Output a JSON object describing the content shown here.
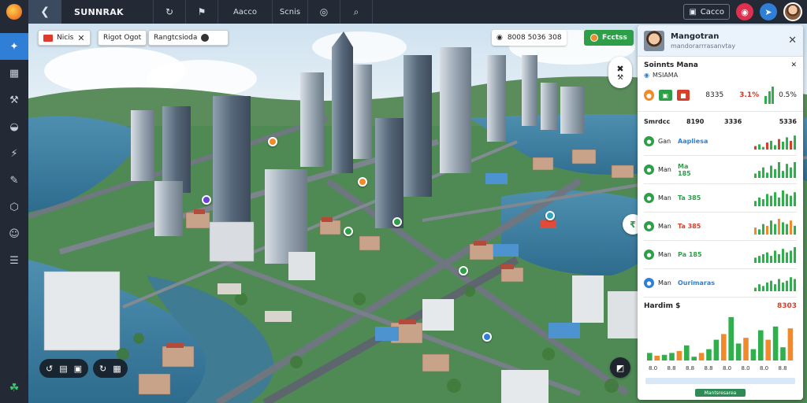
{
  "topbar": {
    "brand": "SUNNRAK",
    "back_icon": "back-arrow-icon",
    "buttons": [
      {
        "label": "",
        "icon": "refresh-icon"
      },
      {
        "label": "",
        "icon": "flag-icon"
      },
      {
        "label": "Aacco",
        "icon": ""
      },
      {
        "label": "Scnis",
        "icon": ""
      },
      {
        "label": "",
        "icon": "target-icon"
      },
      {
        "label": "",
        "icon": "search-icon"
      }
    ],
    "currency_label": "Cacco"
  },
  "sidebar": {
    "items": [
      "add-zone-icon",
      "building-icon",
      "tools-icon",
      "vehicle-icon",
      "power-icon",
      "edit-icon",
      "water-icon",
      "happy-icon",
      "report-icon"
    ],
    "bottom": "settings-icon"
  },
  "map": {
    "chips": [
      {
        "label": "Nicis"
      },
      {
        "label": "Rigot Ogot"
      },
      {
        "label": "Rangtcsioda"
      }
    ],
    "stat_pill": {
      "text": "8008 5036 308"
    },
    "green_button": {
      "label": "Fcctss"
    }
  },
  "panel": {
    "title": "Mangotran",
    "subtitle": "mandorarrrasanvtay",
    "section1": {
      "heading": "Soinnts Mana",
      "sub": "MSIAMA",
      "values": [
        "8335",
        "3.1%",
        "0.5%"
      ]
    },
    "table": {
      "headers": [
        "Smrdcc",
        "8190",
        "3336"
      ],
      "right_header": "5336",
      "rows": [
        {
          "name": "Gan",
          "value": "Aapliesa",
          "color": "#2e9e49"
        },
        {
          "name": "Man",
          "value": "Ma 185",
          "color": "#2e9e49"
        },
        {
          "name": "Man",
          "value": "Ta 385",
          "color": "#2e9e49"
        },
        {
          "name": "Man",
          "value": "Ta 385",
          "color": "#2e9e49"
        },
        {
          "name": "Man",
          "value": "Pa 185",
          "color": "#2e9e49"
        },
        {
          "name": "Man",
          "value": "Ourimaras",
          "color": "#2f7fd6"
        }
      ]
    },
    "big_chart": {
      "heading": "Hardim $",
      "right_label": "8303",
      "x_labels": [
        "8.0",
        "8.8",
        "8.8",
        "8.8",
        "8.0",
        "8.0",
        "8.0",
        "8.8"
      ],
      "button_label": "Mantsresarea"
    }
  },
  "chart_data": {
    "type": "bar",
    "categories": [
      "8.0",
      "8.8",
      "8.8",
      "8.8",
      "8.0",
      "8.0",
      "8.0",
      "8.8"
    ],
    "series": [
      {
        "color": "#2fb04d",
        "values": [
          8,
          9,
          6,
          8,
          14,
          16,
          4,
          10,
          12,
          22,
          36,
          46,
          18,
          30,
          12,
          32,
          26,
          36,
          14,
          42
        ]
      },
      {
        "color": "#f08a2a",
        "values": [
          6,
          5,
          4,
          7,
          10,
          12,
          3,
          8,
          9,
          18,
          28,
          30,
          14,
          24,
          10,
          26,
          22,
          30,
          12,
          34
        ]
      }
    ],
    "title": "Hardim $",
    "ylim": [
      0,
      50
    ]
  },
  "colors": {
    "accent": "#2f7fd6",
    "green": "#2e9e49",
    "orange": "#f08a2a",
    "red": "#d63324"
  }
}
